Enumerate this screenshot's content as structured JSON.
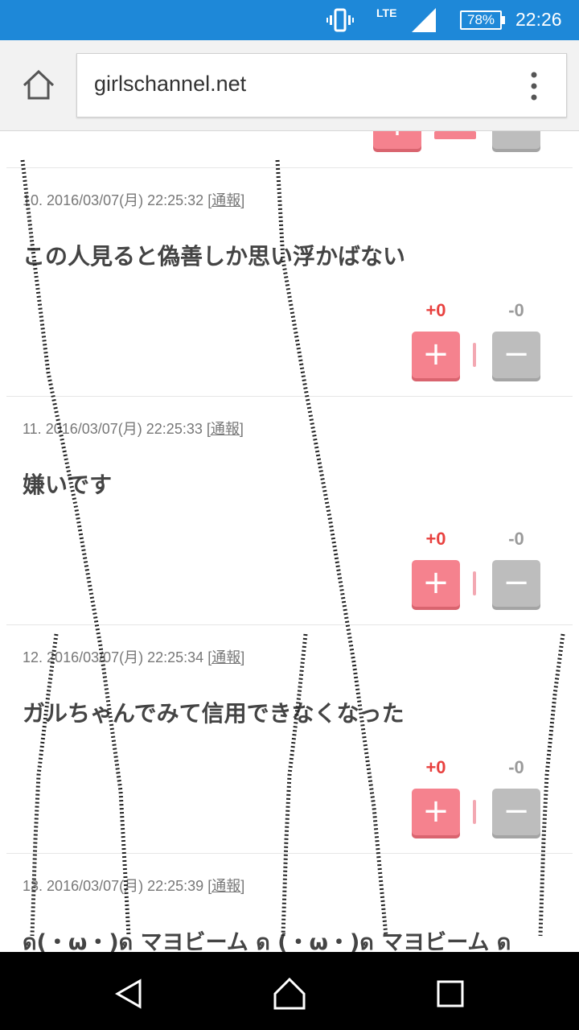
{
  "status_bar": {
    "network": "LTE",
    "battery": "78%",
    "time": "22:26",
    "icons": [
      "vibrate-icon",
      "signal-icon",
      "battery-icon"
    ]
  },
  "browser": {
    "url": "girlschannel.net",
    "icons": [
      "home-icon",
      "menu-dots-icon"
    ]
  },
  "comments": [
    {
      "number": "10.",
      "timestamp": "2016/03/07(月) 22:25:32",
      "report": "[通報]",
      "text": "この人見ると偽善しか思い浮かばない",
      "plus": "+0",
      "minus": "-0"
    },
    {
      "number": "11.",
      "timestamp": "2016/03/07(月) 22:25:33",
      "report": "[通報]",
      "text": "嫌いです",
      "plus": "+0",
      "minus": "-0"
    },
    {
      "number": "12.",
      "timestamp": "2016/03/07(月) 22:25:34",
      "report": "[通報]",
      "text": "ガルちゃんでみて信用できなくなった",
      "plus": "+0",
      "minus": "-0"
    },
    {
      "number": "13.",
      "timestamp": "2016/03/07(月) 22:25:39",
      "report": "[通報]",
      "text": "ด(・ω・)ด マヨビーム ด (・ω・)ด マヨビーム ด"
    }
  ],
  "colors": {
    "status_bar": "#1e88d8",
    "plus_button": "#f5828e",
    "minus_button": "#bdbdbd",
    "plus_count": "#e8413f",
    "minus_count": "#9a9a9a"
  },
  "nav_bar": {
    "icons": [
      "back-icon",
      "home-nav-icon",
      "recents-icon"
    ]
  }
}
